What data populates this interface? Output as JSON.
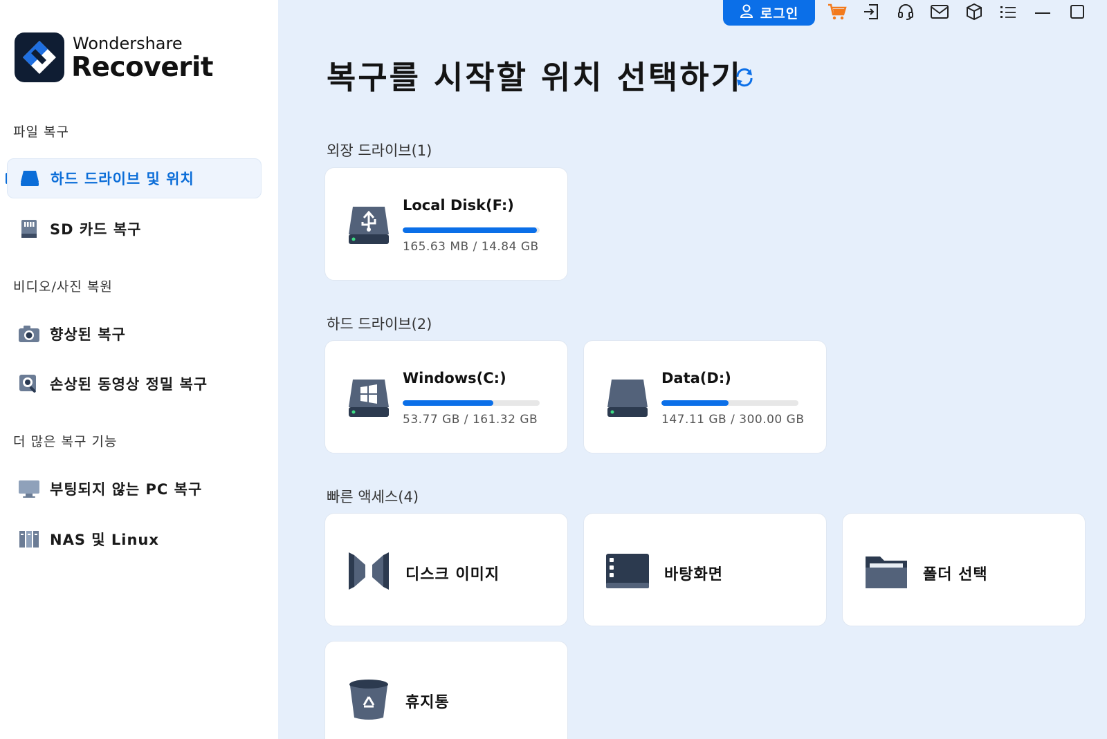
{
  "app": {
    "brand_top": "Wondershare",
    "brand_name": "Recoverit"
  },
  "sidebar": {
    "sections": [
      {
        "title": "파일 복구"
      },
      {
        "title": "비디오/사진 복원"
      },
      {
        "title": "더 많은 복구 기능"
      }
    ],
    "items": [
      {
        "label": "하드 드라이브 및 위치",
        "icon": "hard-drive-icon",
        "active": true
      },
      {
        "label": "SD 카드 복구",
        "icon": "sd-card-icon"
      },
      {
        "label": "향상된 복구",
        "icon": "camera-icon"
      },
      {
        "label": "손상된 동영상 정밀 복구",
        "icon": "video-repair-icon"
      },
      {
        "label": "부팅되지 않는 PC 복구",
        "icon": "monitor-icon"
      },
      {
        "label": "NAS 및 Linux",
        "icon": "nas-icon"
      }
    ]
  },
  "topbar": {
    "login_label": "로그인",
    "icons": [
      "cart-icon",
      "sign-in-icon",
      "headset-icon",
      "mail-icon",
      "box-icon",
      "list-icon",
      "minimize-icon",
      "maximize-icon"
    ],
    "accent": "#0b6fe8"
  },
  "main": {
    "title": "복구를 시작할 위치 선택하기",
    "groups": [
      {
        "title": "외장 드라이브(1)",
        "drives": [
          {
            "name": "Local Disk(F:)",
            "usage": "165.63 MB / 14.84 GB",
            "used_fraction": 0.98,
            "icon": "usb-drive-icon"
          }
        ]
      },
      {
        "title": "하드 드라이브(2)",
        "drives": [
          {
            "name": "Windows(C:)",
            "usage": "53.77 GB / 161.32 GB",
            "used_fraction": 0.66,
            "icon": "windows-drive-icon"
          },
          {
            "name": "Data(D:)",
            "usage": "147.11 GB / 300.00 GB",
            "used_fraction": 0.49,
            "icon": "drive-icon"
          }
        ]
      },
      {
        "title": "빠른 액세스(4)",
        "locations": [
          {
            "label": "디스크 이미지",
            "icon": "disk-image-icon"
          },
          {
            "label": "바탕화면",
            "icon": "desktop-icon"
          },
          {
            "label": "폴더 선택",
            "icon": "folder-icon"
          },
          {
            "label": "휴지통",
            "icon": "recycle-bin-icon"
          }
        ]
      }
    ]
  }
}
